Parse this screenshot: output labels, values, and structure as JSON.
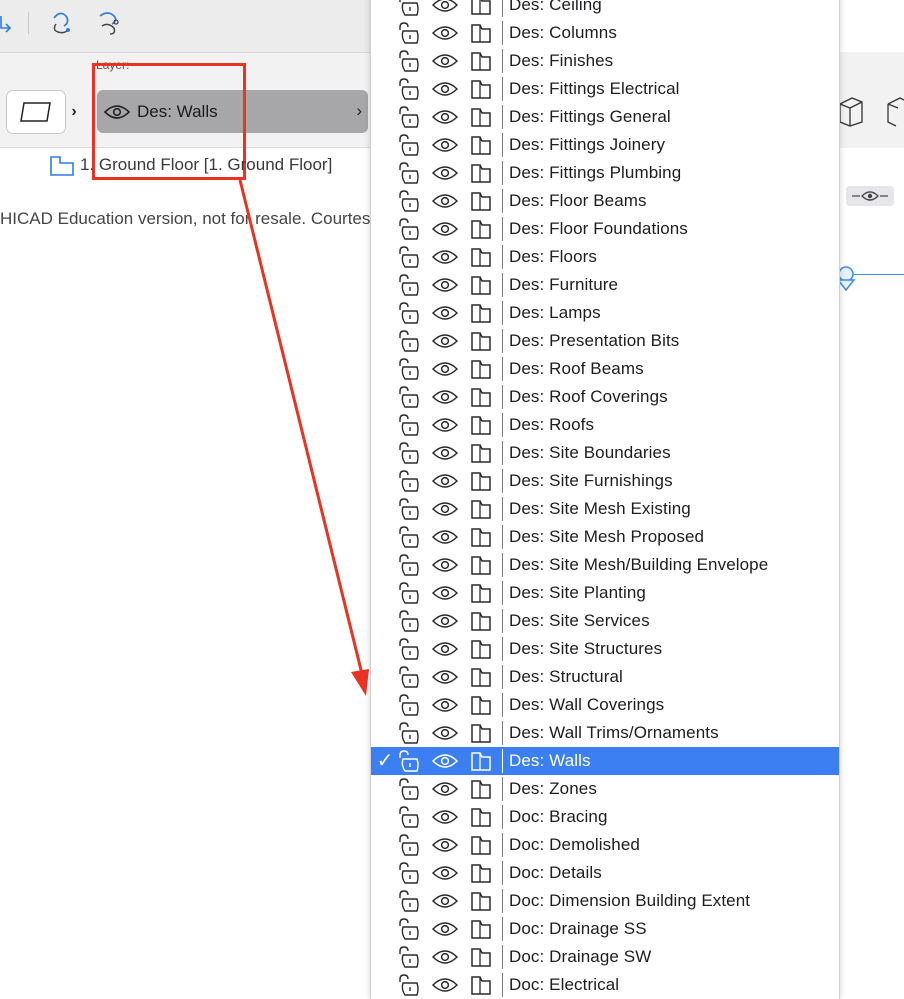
{
  "infobox": {
    "layer_caption": "Layer:",
    "layer_value": "Des: Walls",
    "story": "1. Ground Floor [1. Ground Floor]",
    "watermark": "HICAD Education version, not for resale. Courtes"
  },
  "menu": {
    "selected": "Des: Walls",
    "items": [
      "Des: Ceiling",
      "Des: Columns",
      "Des: Finishes",
      "Des: Fittings Electrical",
      "Des: Fittings General",
      "Des: Fittings Joinery",
      "Des: Fittings Plumbing",
      "Des: Floor Beams",
      "Des: Floor Foundations",
      "Des: Floors",
      "Des: Furniture",
      "Des: Lamps",
      "Des: Presentation Bits",
      "Des: Roof Beams",
      "Des: Roof Coverings",
      "Des: Roofs",
      "Des: Site Boundaries",
      "Des: Site Furnishings",
      "Des: Site Mesh Existing",
      "Des: Site Mesh Proposed",
      "Des: Site Mesh/Building Envelope",
      "Des: Site Planting",
      "Des: Site Services",
      "Des: Site Structures",
      "Des: Structural",
      "Des: Wall Coverings",
      "Des: Wall Trims/Ornaments",
      "Des: Walls",
      "Des: Zones",
      "Doc: Bracing",
      "Doc: Demolished",
      "Doc: Details",
      "Doc: Dimension Building Extent",
      "Doc: Drainage SS",
      "Doc: Drainage SW",
      "Doc: Electrical"
    ]
  },
  "colors": {
    "selection": "#3b7ff2",
    "annotation": "#ea3323",
    "selector_bg": "#a7a7aa"
  },
  "icons": {
    "row_icons": [
      "lock-open-icon",
      "eye-icon",
      "wireframe-icon"
    ],
    "check": "✓"
  }
}
